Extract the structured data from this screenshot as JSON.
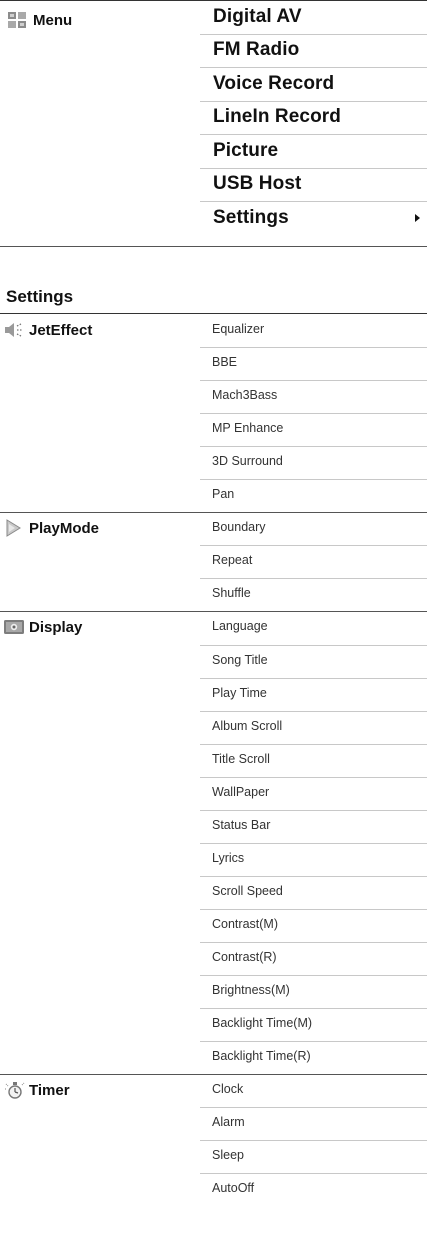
{
  "menu": {
    "label": "Menu",
    "icon": "menu-grid-icon",
    "items": [
      {
        "label": "Digital AV"
      },
      {
        "label": "FM Radio"
      },
      {
        "label": "Voice Record"
      },
      {
        "label": "LineIn Record"
      },
      {
        "label": "Picture"
      },
      {
        "label": "USB Host"
      },
      {
        "label": "Settings",
        "has_submenu": true
      }
    ]
  },
  "settings": {
    "title": "Settings",
    "categories": [
      {
        "label": "JetEffect",
        "icon": "speaker-icon",
        "items": [
          "Equalizer",
          "BBE",
          "Mach3Bass",
          "MP Enhance",
          "3D Surround",
          "Pan"
        ]
      },
      {
        "label": "PlayMode",
        "icon": "play-icon",
        "items": [
          "Boundary",
          "Repeat",
          "Shuffle"
        ]
      },
      {
        "label": "Display",
        "icon": "display-icon",
        "items": [
          "Language",
          "Song Title",
          "Play Time",
          "Album Scroll",
          "Title Scroll",
          "WallPaper",
          "Status Bar",
          "Lyrics",
          "Scroll Speed",
          "Contrast(M)",
          "Contrast(R)",
          "Brightness(M)",
          "Backlight Time(M)",
          "Backlight Time(R)"
        ]
      },
      {
        "label": "Timer",
        "icon": "timer-icon",
        "items": [
          "Clock",
          "Alarm",
          "Sleep",
          "AutoOff"
        ]
      }
    ]
  }
}
